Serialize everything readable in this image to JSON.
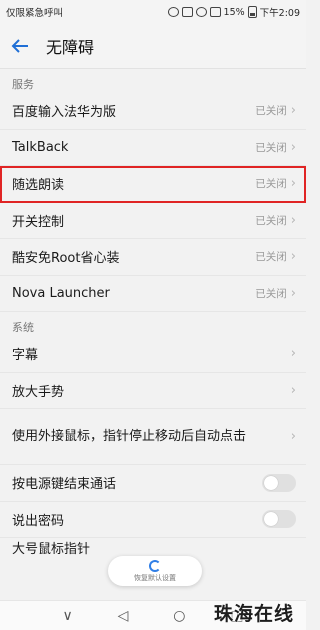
{
  "statusbar": {
    "left": "仅限紧急呼叫",
    "battery": "15%",
    "time": "下午2:09"
  },
  "header": {
    "title": "无障碍"
  },
  "sections": {
    "services": {
      "label": "服务",
      "items": [
        {
          "label": "百度输入法华为版",
          "state": "已关闭"
        },
        {
          "label": "TalkBack",
          "state": "已关闭"
        },
        {
          "label": "随选朗读",
          "state": "已关闭"
        },
        {
          "label": "开关控制",
          "state": "已关闭"
        },
        {
          "label": "酷安免Root省心装",
          "state": "已关闭"
        },
        {
          "label": "Nova Launcher",
          "state": "已关闭"
        }
      ]
    },
    "system": {
      "label": "系统",
      "items": [
        {
          "label": "字幕"
        },
        {
          "label": "放大手势"
        },
        {
          "label": "使用外接鼠标，指针停止移动后自动点击"
        },
        {
          "label": "按电源键结束通话"
        },
        {
          "label": "说出密码"
        },
        {
          "label": "大号鼠标指针"
        }
      ]
    }
  },
  "restore": {
    "label": "恢复默认设置"
  },
  "watermark": "珠海在线"
}
